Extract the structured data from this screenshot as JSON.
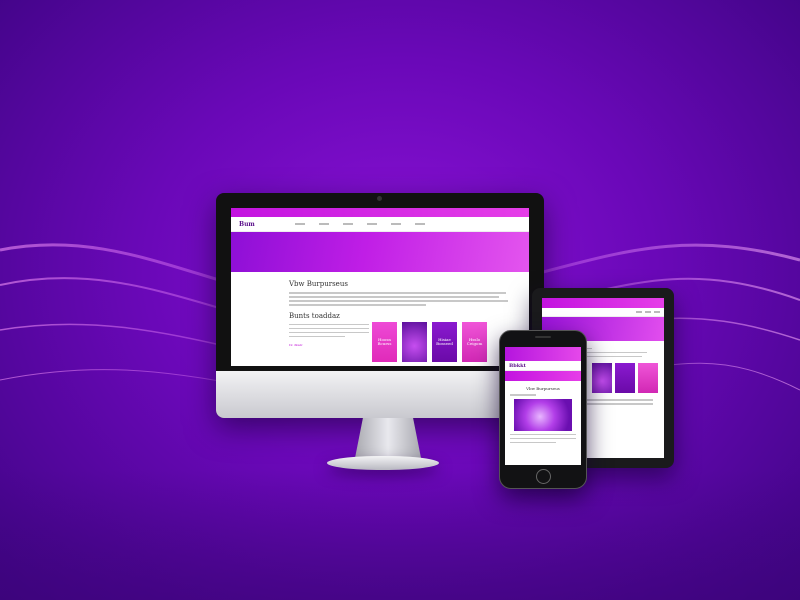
{
  "scene": {
    "background_color": "#6a08b8",
    "accent_color": "#d21fe6",
    "devices": [
      "desktop-monitor",
      "tablet",
      "phone"
    ]
  },
  "desktop": {
    "site": {
      "logo": "Bum",
      "heading_1": "Vbw Burpurseus",
      "heading_2": "Bunts toaddaz",
      "link_text": "Ftr. iblisdz",
      "cards": [
        "Hoosn Bcurss",
        "",
        "Hisiae Bosseed",
        "Hsslo Ceigom"
      ]
    }
  },
  "tablet": {
    "site": {
      "cards": [
        "",
        "",
        ""
      ]
    }
  },
  "phone": {
    "site": {
      "logo": "Bbkkt",
      "heading": "Vbw Burpurseus"
    }
  }
}
